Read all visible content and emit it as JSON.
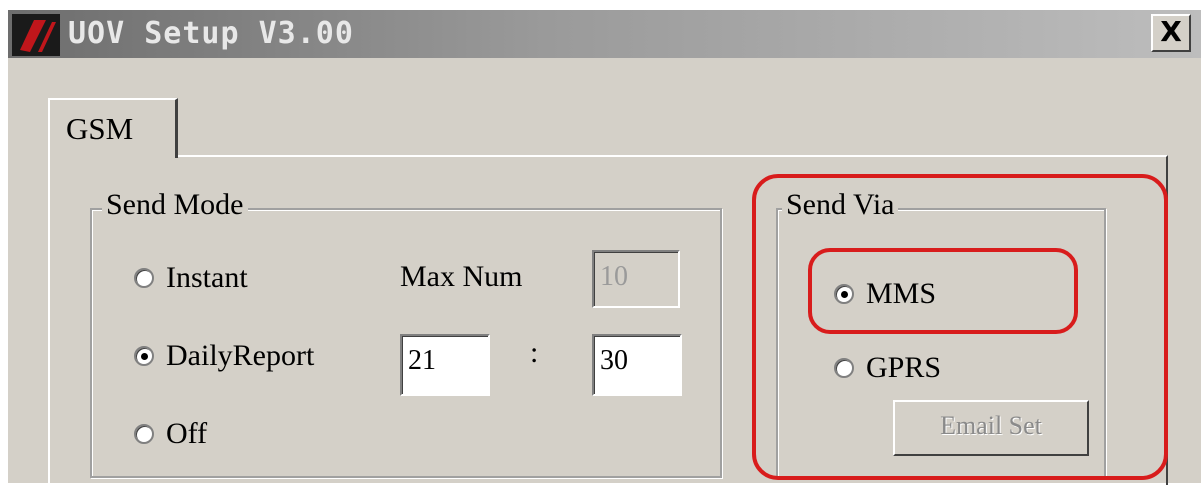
{
  "window": {
    "title": "UOV Setup V3.00",
    "close_symbol": "X"
  },
  "tabs": [
    {
      "label": "GSM",
      "active": true
    }
  ],
  "send_mode": {
    "group_label": "Send Mode",
    "options": [
      {
        "label": "Instant",
        "selected": false
      },
      {
        "label": "DailyReport",
        "selected": true
      },
      {
        "label": "Off",
        "selected": false
      }
    ],
    "max_num_label": "Max Num",
    "max_num_value": "10",
    "hour_value": "21",
    "separator": ":",
    "minute_value": "30"
  },
  "send_via": {
    "group_label": "Send Via",
    "options": [
      {
        "label": "MMS",
        "selected": true
      },
      {
        "label": "GPRS",
        "selected": false
      }
    ],
    "email_button_label": "Email Set"
  },
  "annotation_color": "#d81c1c",
  "icons": {
    "app": "app-logo-icon",
    "close": "close-icon"
  }
}
